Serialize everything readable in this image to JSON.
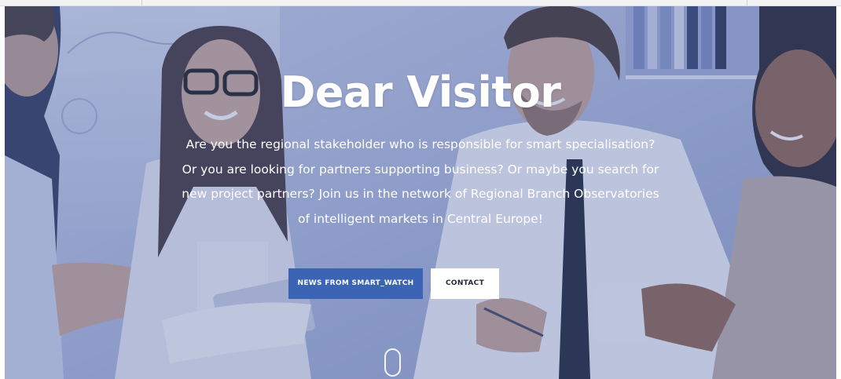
{
  "hero": {
    "title": "Dear Visitor",
    "text": "Are you the regional stakeholder who is responsible for smart specialisation? Or you are looking for partners supporting business? Or maybe you search for new project partners? Join us in the network of Regional Branch Observatories of intelligent markets in Central Europe!",
    "buttons": {
      "news_label": "NEWS FROM SMART_WATCH",
      "contact_label": "CONTACT"
    },
    "colors": {
      "overlay": "#586caa",
      "primary_button": "#3b64b4",
      "secondary_button": "#ffffff"
    },
    "icons": {
      "scroll": "scroll-down-mouse-icon"
    }
  }
}
